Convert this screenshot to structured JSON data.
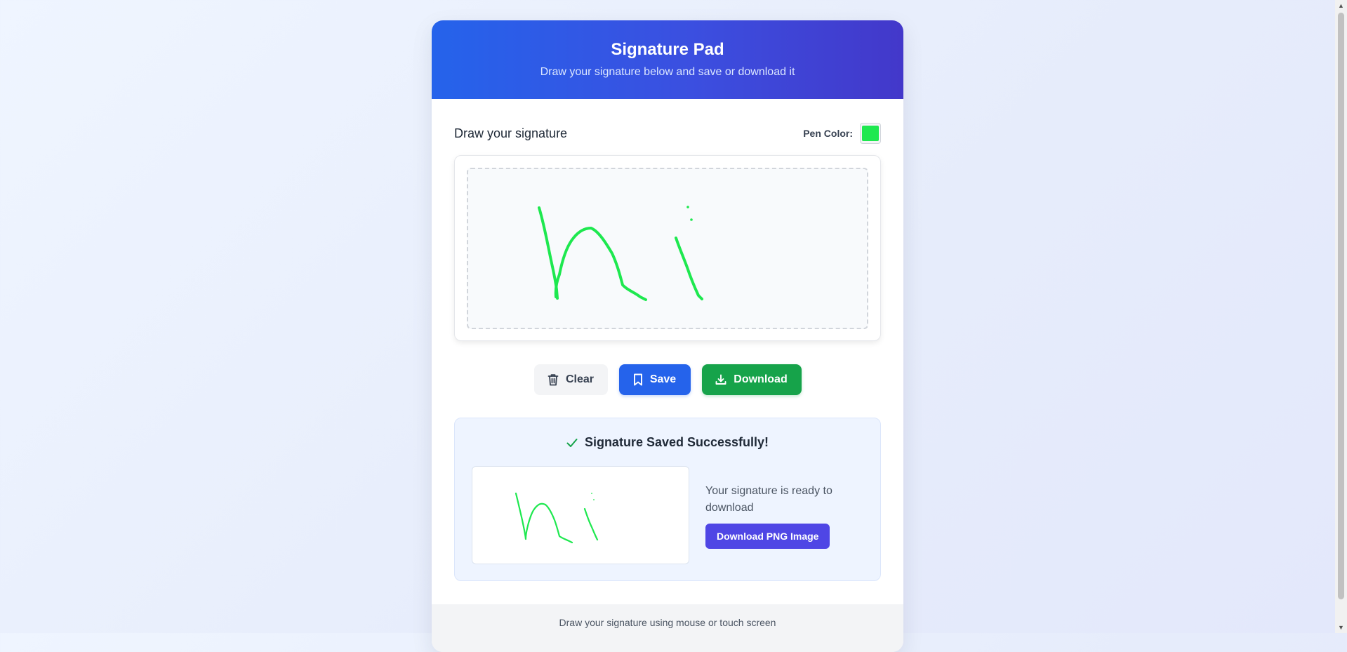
{
  "header": {
    "title": "Signature Pad",
    "subtitle": "Draw your signature below and save or download it"
  },
  "pad": {
    "label": "Draw your signature",
    "pen_color_label": "Pen Color:",
    "pen_color": "#1ee84f"
  },
  "buttons": {
    "clear": "Clear",
    "save": "Save",
    "download": "Download"
  },
  "saved": {
    "title": "Signature Saved Successfully!",
    "ready_text": "Your signature is ready to download",
    "download_png": "Download PNG Image"
  },
  "footer": {
    "text": "Draw your signature using mouse or touch screen"
  },
  "colors": {
    "primary": "#2563eb",
    "success": "#16a34a",
    "indigo": "#4f46e5",
    "check": "#16a34a"
  }
}
